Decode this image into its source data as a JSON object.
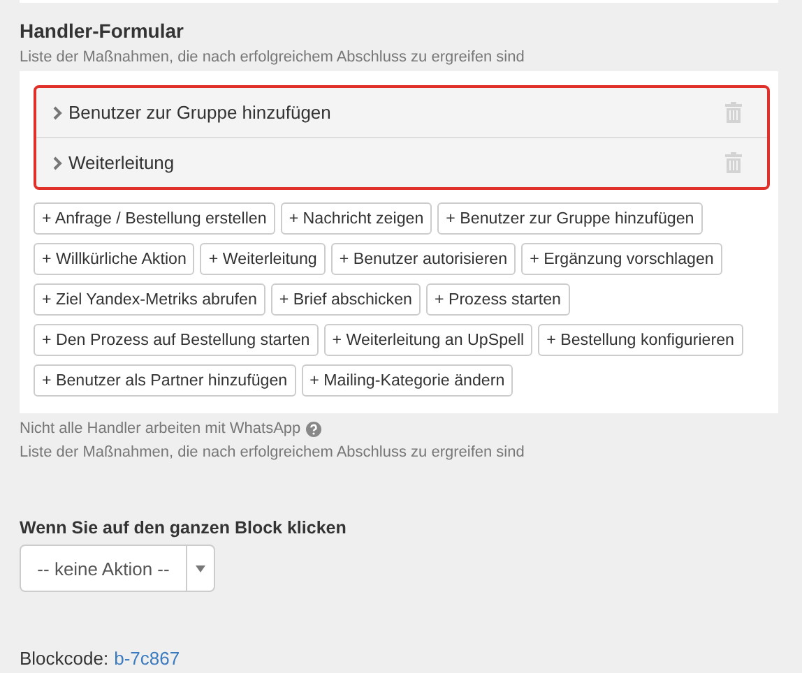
{
  "section": {
    "title": "Handler-Formular",
    "description": "Liste der Maßnahmen, die nach erfolgreichem Abschluss zu ergreifen sind"
  },
  "handlers": [
    {
      "label": "Benutzer zur Gruppe hinzufügen",
      "expanded": false
    },
    {
      "label": "Weiterleitung",
      "expanded": false
    }
  ],
  "add_buttons": [
    "+ Anfrage / Bestellung erstellen",
    "+ Nachricht zeigen",
    "+ Benutzer zur Gruppe hinzufügen",
    "+ Willkürliche Aktion",
    "+ Weiterleitung",
    "+ Benutzer autorisieren",
    "+ Ergänzung vorschlagen",
    "+ Ziel Yandex-Metriks abrufen",
    "+ Brief abschicken",
    "+ Prozess starten",
    "+ Den Prozess auf Bestellung starten",
    "+ Weiterleitung an UpSpell",
    "+ Bestellung konfigurieren",
    "+ Benutzer als Partner hinzufügen",
    "+ Mailing-Kategorie ändern"
  ],
  "note": "Nicht alle Handler arbeiten mit WhatsApp",
  "description_repeat": "Liste der Maßnahmen, die nach erfolgreichem Abschluss zu ergreifen sind",
  "click_action": {
    "label": "Wenn Sie auf den ganzen Block klicken",
    "value": "-- keine Aktion --"
  },
  "block_code": {
    "label": "Blockcode:",
    "value": "b-7c867"
  }
}
